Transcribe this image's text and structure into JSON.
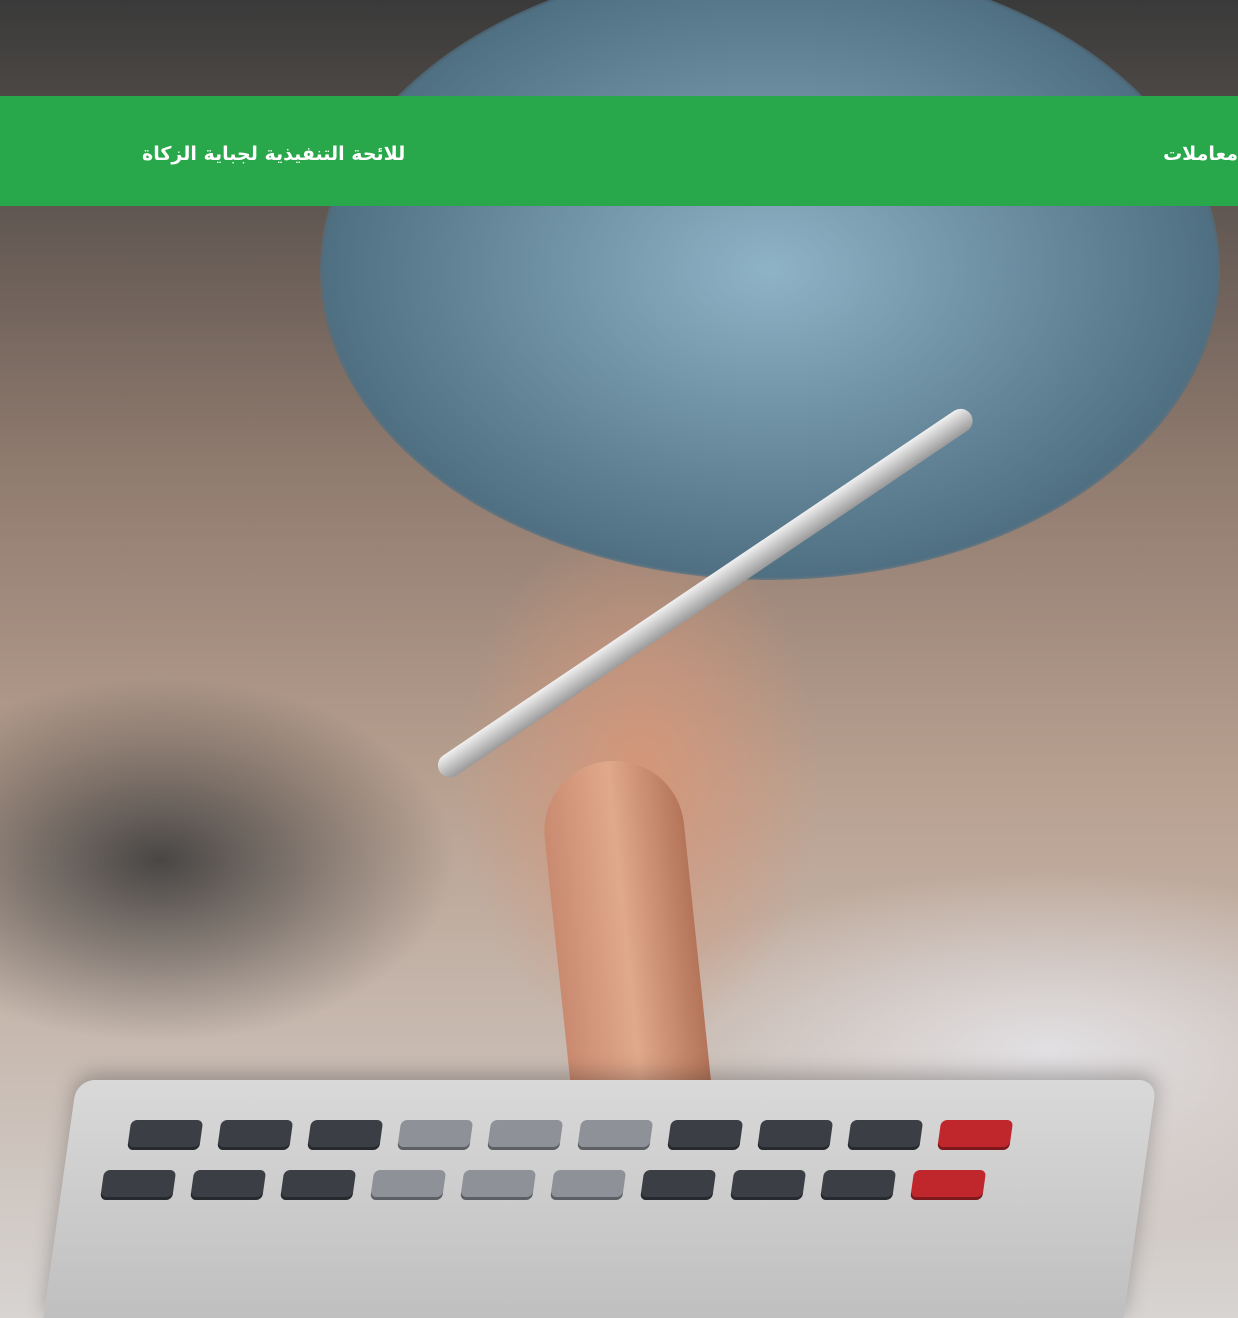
{
  "banner": {
    "left_text": "للائحة التنفيذية لجباية الزكاة",
    "right_text": "معاملات",
    "background_color": "#28a84a",
    "text_color": "#ffffff"
  },
  "hero": {
    "image": "hand-with-pen-pressing-calculator-key"
  }
}
